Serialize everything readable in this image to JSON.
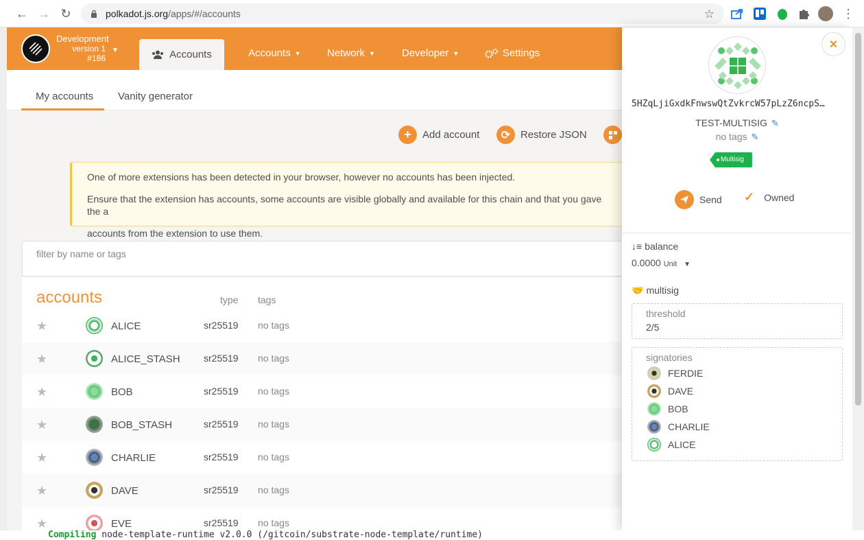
{
  "browser": {
    "url_host": "polkadot.js.org",
    "url_path": "/apps/#/accounts"
  },
  "chain": {
    "name": "Development",
    "version": "version 1",
    "block": "#186"
  },
  "nav": {
    "active_tab": "Accounts",
    "menus": [
      "Accounts",
      "Network",
      "Developer",
      "Settings"
    ]
  },
  "subtabs": [
    "My accounts",
    "Vanity generator"
  ],
  "actions": {
    "add_account": "Add account",
    "restore_json": "Restore JSON"
  },
  "warning": {
    "line1": "One of more extensions has been detected in your browser, however no accounts has been injected.",
    "line2": "Ensure that the extension has accounts, some accounts are visible globally and available for this chain and that you gave the a",
    "line3": "accounts from the extension to use them."
  },
  "filter": {
    "placeholder": "filter by name or tags"
  },
  "accounts_table": {
    "title": "accounts",
    "col_type": "type",
    "col_tags": "tags",
    "rows": [
      {
        "name": "ALICE",
        "type": "sr25519",
        "tags": "no tags"
      },
      {
        "name": "ALICE_STASH",
        "type": "sr25519",
        "tags": "no tags"
      },
      {
        "name": "BOB",
        "type": "sr25519",
        "tags": "no tags"
      },
      {
        "name": "BOB_STASH",
        "type": "sr25519",
        "tags": "no tags"
      },
      {
        "name": "CHARLIE",
        "type": "sr25519",
        "tags": "no tags"
      },
      {
        "name": "DAVE",
        "type": "sr25519",
        "tags": "no tags"
      },
      {
        "name": "EVE",
        "type": "sr25519",
        "tags": "no tags"
      }
    ]
  },
  "panel": {
    "address": "5HZqLjiGxdkFnwswQtZvkrcW57pLzZ6ncpS…",
    "name": "TEST-MULTISIG",
    "tags": "no tags",
    "badge": "Multisig",
    "send": "Send",
    "owned": "Owned",
    "balance_label": "balance",
    "balance_value": "0.0000",
    "balance_unit": "Unit",
    "multisig_label": "multisig",
    "threshold_label": "threshold",
    "threshold_value": "2/5",
    "signatories_label": "signatories",
    "signatories": [
      "FERDIE",
      "DAVE",
      "BOB",
      "CHARLIE",
      "ALICE"
    ]
  },
  "terminal": {
    "word": "Compiling",
    "rest": "node-template-runtime v2.0.0 (/gitcoin/substrate-node-template/runtime)"
  },
  "colors": {
    "accent": "#f19135",
    "badge": "#1cb34a",
    "edit": "#2e86de"
  }
}
